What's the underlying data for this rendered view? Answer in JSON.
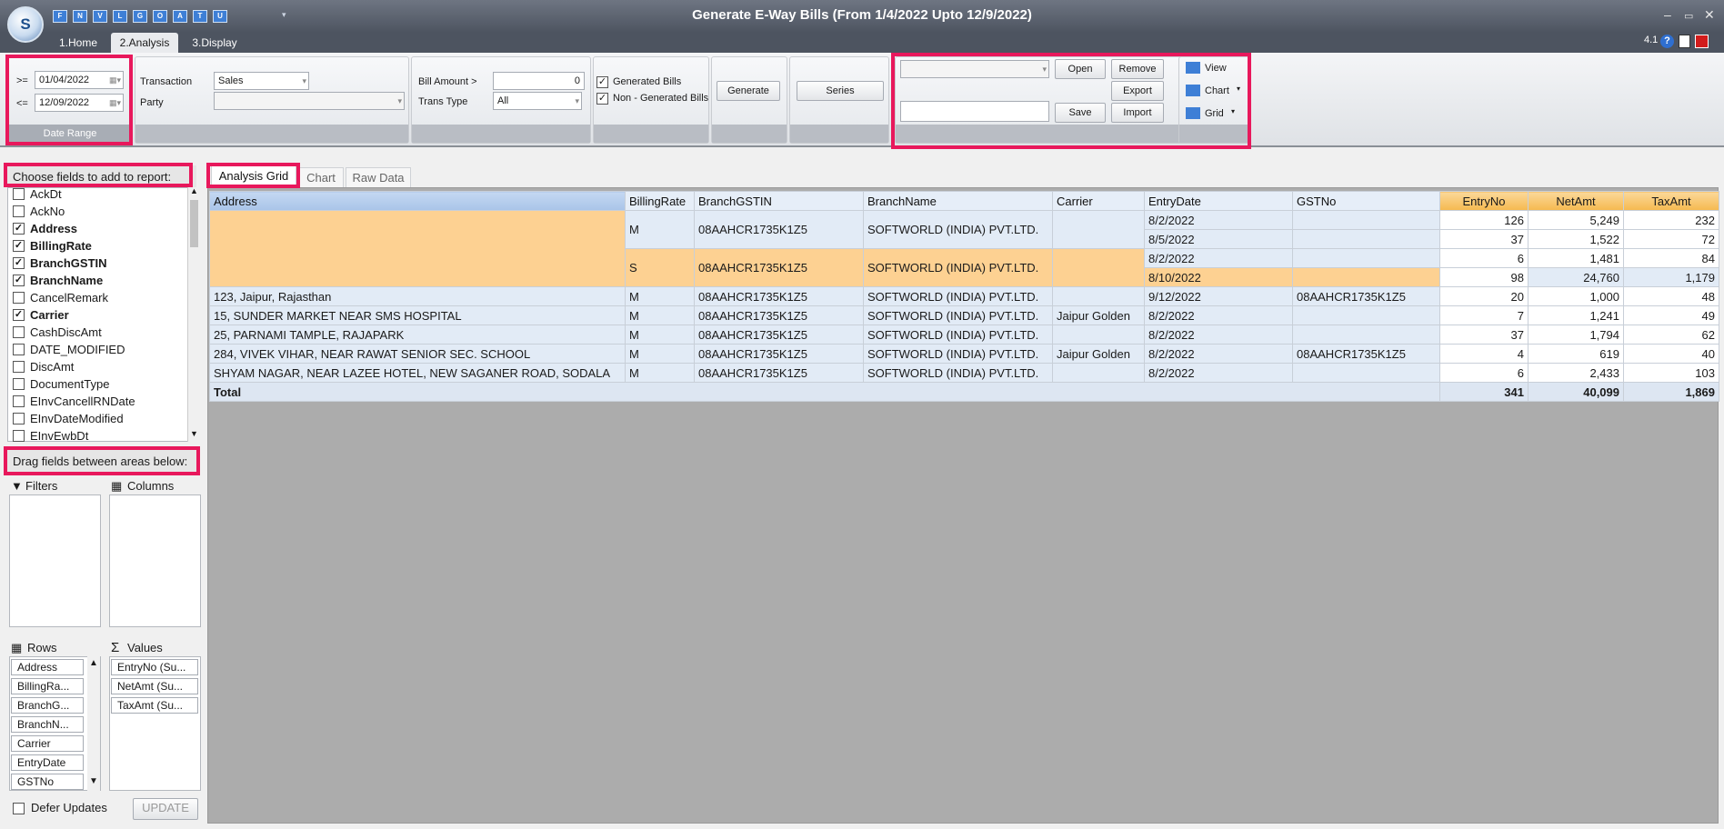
{
  "window": {
    "title": "Generate E-Way Bills (From 1/4/2022 Upto 12/9/2022)",
    "version": "4.1"
  },
  "app_logo": "S",
  "quick_access": [
    "F",
    "N",
    "V",
    "L",
    "G",
    "O",
    "A",
    "T",
    "U"
  ],
  "ribbon_tabs": [
    "1.Home",
    "2.Analysis",
    "3.Display"
  ],
  "date_range": {
    "ge_label": ">=",
    "from": "01/04/2022",
    "le_label": "<=",
    "to": "12/09/2022",
    "group_label": "Date Range"
  },
  "filters": {
    "transaction_label": "Transaction",
    "transaction_value": "Sales",
    "party_label": "Party",
    "party_value": "",
    "bill_amount_label": "Bill Amount >",
    "bill_amount_value": "0",
    "trans_type_label": "Trans Type",
    "trans_type_value": "All"
  },
  "bills": {
    "generated_label": "Generated Bills",
    "generated_checked": true,
    "non_generated_label": "Non - Generated Bills",
    "non_generated_checked": true
  },
  "buttons": {
    "generate": "Generate",
    "series": "Series",
    "open": "Open",
    "remove": "Remove",
    "export": "Export",
    "save": "Save",
    "import": "Import",
    "view": "View",
    "chart": "Chart",
    "grid": "Grid",
    "update": "UPDATE"
  },
  "layout_selector": {
    "value": "",
    "name_value": ""
  },
  "field_list": {
    "header": "Choose fields to add to report:",
    "items": [
      {
        "label": "AckDt",
        "checked": false
      },
      {
        "label": "AckNo",
        "checked": false
      },
      {
        "label": "Address",
        "checked": true
      },
      {
        "label": "BillingRate",
        "checked": true
      },
      {
        "label": "BranchGSTIN",
        "checked": true
      },
      {
        "label": "BranchName",
        "checked": true
      },
      {
        "label": "CancelRemark",
        "checked": false
      },
      {
        "label": "Carrier",
        "checked": true
      },
      {
        "label": "CashDiscAmt",
        "checked": false
      },
      {
        "label": "DATE_MODIFIED",
        "checked": false
      },
      {
        "label": "DiscAmt",
        "checked": false
      },
      {
        "label": "DocumentType",
        "checked": false
      },
      {
        "label": "EInvCancellRNDate",
        "checked": false
      },
      {
        "label": "EInvDateModified",
        "checked": false
      },
      {
        "label": "EInvEwbDt",
        "checked": false
      }
    ]
  },
  "areas": {
    "header": "Drag fields between areas below:",
    "filters": "Filters",
    "columns": "Columns",
    "rows": "Rows",
    "values": "Values",
    "row_fields": [
      "Address",
      "BillingRa...",
      "BranchG...",
      "BranchN...",
      "Carrier",
      "EntryDate",
      "GSTNo"
    ],
    "value_fields": [
      "EntryNo (Su...",
      "NetAmt (Su...",
      "TaxAmt (Su..."
    ]
  },
  "defer_updates": {
    "label": "Defer Updates",
    "checked": false
  },
  "view_tabs": [
    "Analysis Grid",
    "Chart",
    "Raw Data"
  ],
  "grid": {
    "row_headers": [
      "Address",
      "BillingRate",
      "BranchGSTIN",
      "BranchName",
      "Carrier",
      "EntryDate",
      "GSTNo"
    ],
    "value_headers": [
      "EntryNo",
      "NetAmt",
      "TaxAmt"
    ],
    "rows": [
      {
        "address": "",
        "rate": "M",
        "gstin": "08AAHCR1735K1Z5",
        "branch": "SOFTWORLD (INDIA) PVT.LTD.",
        "carrier": "",
        "date": "8/2/2022",
        "gst": "",
        "entry": "126",
        "net": "5,249",
        "tax": "232"
      },
      {
        "address": "",
        "rate": "",
        "gstin": "",
        "branch": "",
        "carrier": "",
        "date": "8/5/2022",
        "gst": "",
        "entry": "37",
        "net": "1,522",
        "tax": "72"
      },
      {
        "address": "",
        "rate": "S",
        "gstin": "08AAHCR1735K1Z5",
        "branch": "SOFTWORLD (INDIA) PVT.LTD.",
        "carrier": "",
        "date": "8/2/2022",
        "gst": "",
        "entry": "6",
        "net": "1,481",
        "tax": "84"
      },
      {
        "address": "",
        "rate": "",
        "gstin": "",
        "branch": "",
        "carrier": "",
        "date": "8/10/2022",
        "gst": "",
        "entry": "98",
        "net": "24,760",
        "tax": "1,179"
      },
      {
        "address": "123, Jaipur, Rajasthan",
        "rate": "M",
        "gstin": "08AAHCR1735K1Z5",
        "branch": "SOFTWORLD (INDIA) PVT.LTD.",
        "carrier": "",
        "date": "9/12/2022",
        "gst": "08AAHCR1735K1Z5",
        "entry": "20",
        "net": "1,000",
        "tax": "48"
      },
      {
        "address": "15, SUNDER MARKET NEAR SMS HOSPITAL",
        "rate": "M",
        "gstin": "08AAHCR1735K1Z5",
        "branch": "SOFTWORLD (INDIA) PVT.LTD.",
        "carrier": "Jaipur Golden",
        "date": "8/2/2022",
        "gst": "",
        "entry": "7",
        "net": "1,241",
        "tax": "49"
      },
      {
        "address": "25, PARNAMI TAMPLE, RAJAPARK",
        "rate": "M",
        "gstin": "08AAHCR1735K1Z5",
        "branch": "SOFTWORLD (INDIA) PVT.LTD.",
        "carrier": "",
        "date": "8/2/2022",
        "gst": "",
        "entry": "37",
        "net": "1,794",
        "tax": "62"
      },
      {
        "address": "284, VIVEK VIHAR, NEAR RAWAT SENIOR  SEC. SCHOOL",
        "rate": "M",
        "gstin": "08AAHCR1735K1Z5",
        "branch": "SOFTWORLD (INDIA) PVT.LTD.",
        "carrier": "Jaipur Golden",
        "date": "8/2/2022",
        "gst": "08AAHCR1735K1Z5",
        "entry": "4",
        "net": "619",
        "tax": "40"
      },
      {
        "address": "SHYAM NAGAR, NEAR LAZEE HOTEL, NEW SAGANER ROAD, SODALA",
        "rate": "M",
        "gstin": "08AAHCR1735K1Z5",
        "branch": "SOFTWORLD (INDIA) PVT.LTD.",
        "carrier": "",
        "date": "8/2/2022",
        "gst": "",
        "entry": "6",
        "net": "2,433",
        "tax": "103"
      }
    ],
    "total": {
      "label": "Total",
      "entry": "341",
      "net": "40,099",
      "tax": "1,869"
    }
  },
  "colors": {
    "highlight": "#e8185c",
    "header_blue": "#a9c4e8",
    "header_orange": "#f5b94f",
    "titlebar": "#5a616d"
  }
}
